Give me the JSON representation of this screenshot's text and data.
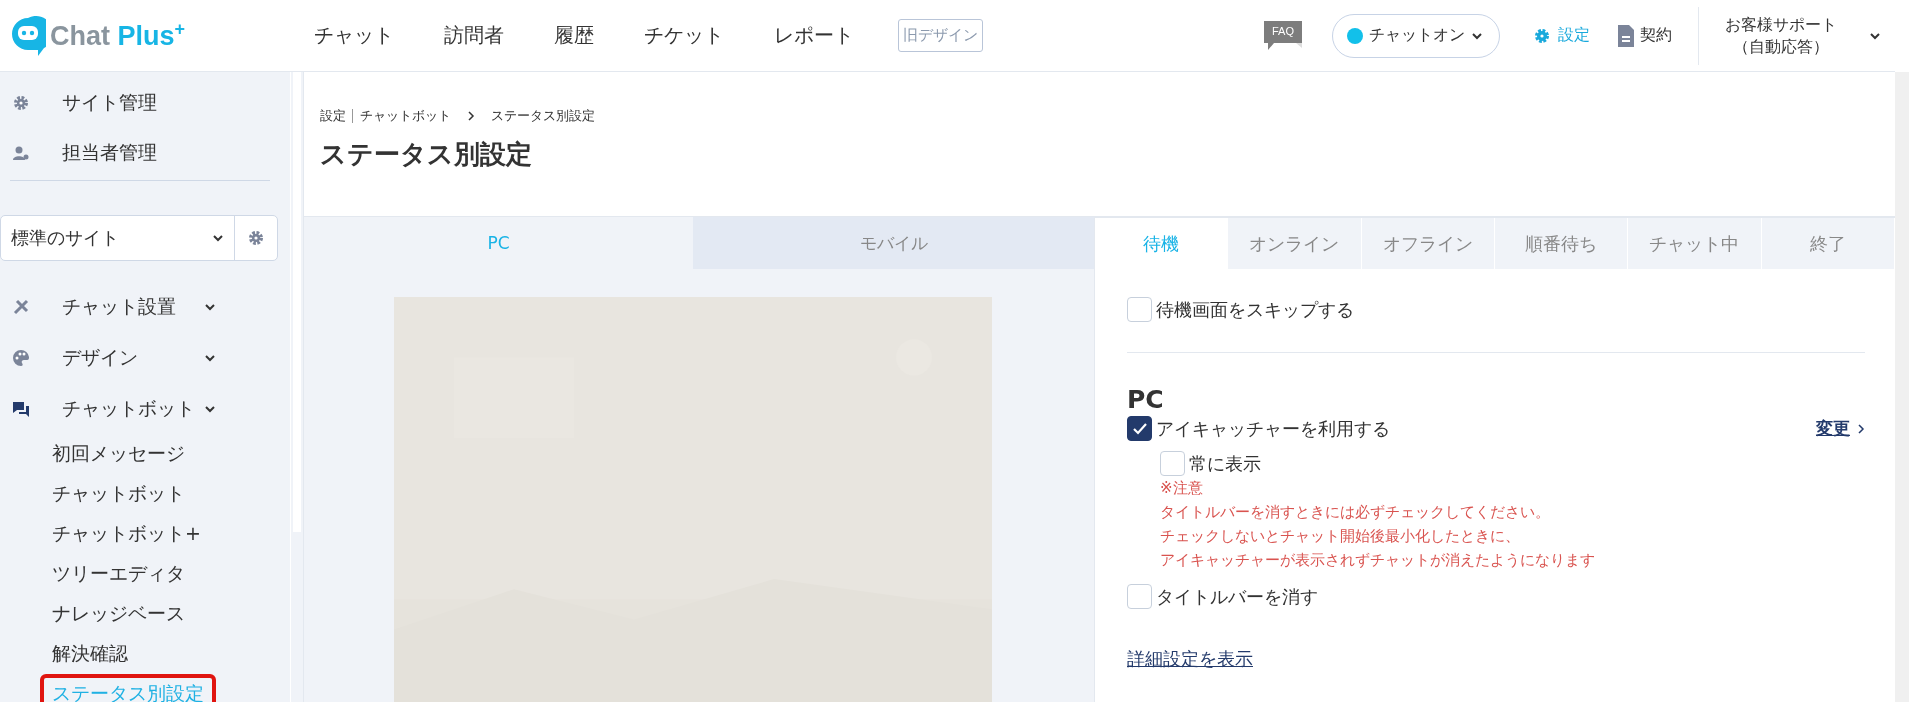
{
  "header": {
    "logo": {
      "name": "Chat",
      "accent": "Plus",
      "sup": "+"
    },
    "nav": [
      {
        "label": "チャット"
      },
      {
        "label": "訪問者"
      },
      {
        "label": "履歴"
      },
      {
        "label": "チケット"
      },
      {
        "label": "レポート"
      }
    ],
    "old_design": "旧デザイン",
    "faq": "FAQ",
    "chat_status": {
      "label": "チャットオン",
      "online": true
    },
    "settings": "設定",
    "contract": "契約",
    "user": {
      "line1": "お客様サポート",
      "line2": "（自動応答）"
    }
  },
  "sidebar": {
    "top_items": [
      {
        "label": "サイト管理"
      },
      {
        "label": "担当者管理"
      }
    ],
    "site_select": "標準のサイト",
    "groups": [
      {
        "label": "チャット設置"
      },
      {
        "label": "デザイン"
      },
      {
        "label": "チャットボット",
        "children": [
          {
            "label": "初回メッセージ",
            "selected": false
          },
          {
            "label": "チャットボット",
            "selected": false
          },
          {
            "label": "チャットボット+",
            "selected": false
          },
          {
            "label": "ツリーエディタ",
            "selected": false
          },
          {
            "label": "ナレッジベース",
            "selected": false
          },
          {
            "label": "解決確認",
            "selected": false
          },
          {
            "label": "ステータス別設定",
            "selected": true
          }
        ]
      }
    ]
  },
  "breadcrumb": {
    "items": [
      "設定",
      "チャットボット"
    ],
    "current": "ステータス別設定"
  },
  "page_title": "ステータス別設定",
  "device_tabs": [
    {
      "label": "PC",
      "selected": true
    },
    {
      "label": "モバイル",
      "selected": false
    }
  ],
  "status_tabs": [
    {
      "label": "待機",
      "selected": true
    },
    {
      "label": "オンライン",
      "selected": false
    },
    {
      "label": "オフライン",
      "selected": false
    },
    {
      "label": "順番待ち",
      "selected": false
    },
    {
      "label": "チャット中",
      "selected": false
    },
    {
      "label": "終了",
      "selected": false
    }
  ],
  "skip_option": {
    "label": "待機画面をスキップする",
    "checked": false
  },
  "pc_section": {
    "heading": "PC",
    "eyecatcher": {
      "label": "アイキャッチャーを利用する",
      "checked": true,
      "change_link": "変更"
    },
    "always_show": {
      "label": "常に表示",
      "checked": false
    },
    "notice": [
      "※注意",
      "タイトルバーを消すときには必ずチェックしてください。",
      "チェックしないとチャット開始後最小化したときに、",
      "アイキャッチャーが表示されずチャットが消えたようになります"
    ],
    "hide_titlebar": {
      "label": "タイトルバーを消す",
      "checked": false
    }
  },
  "details_link": "詳細設定を表示"
}
